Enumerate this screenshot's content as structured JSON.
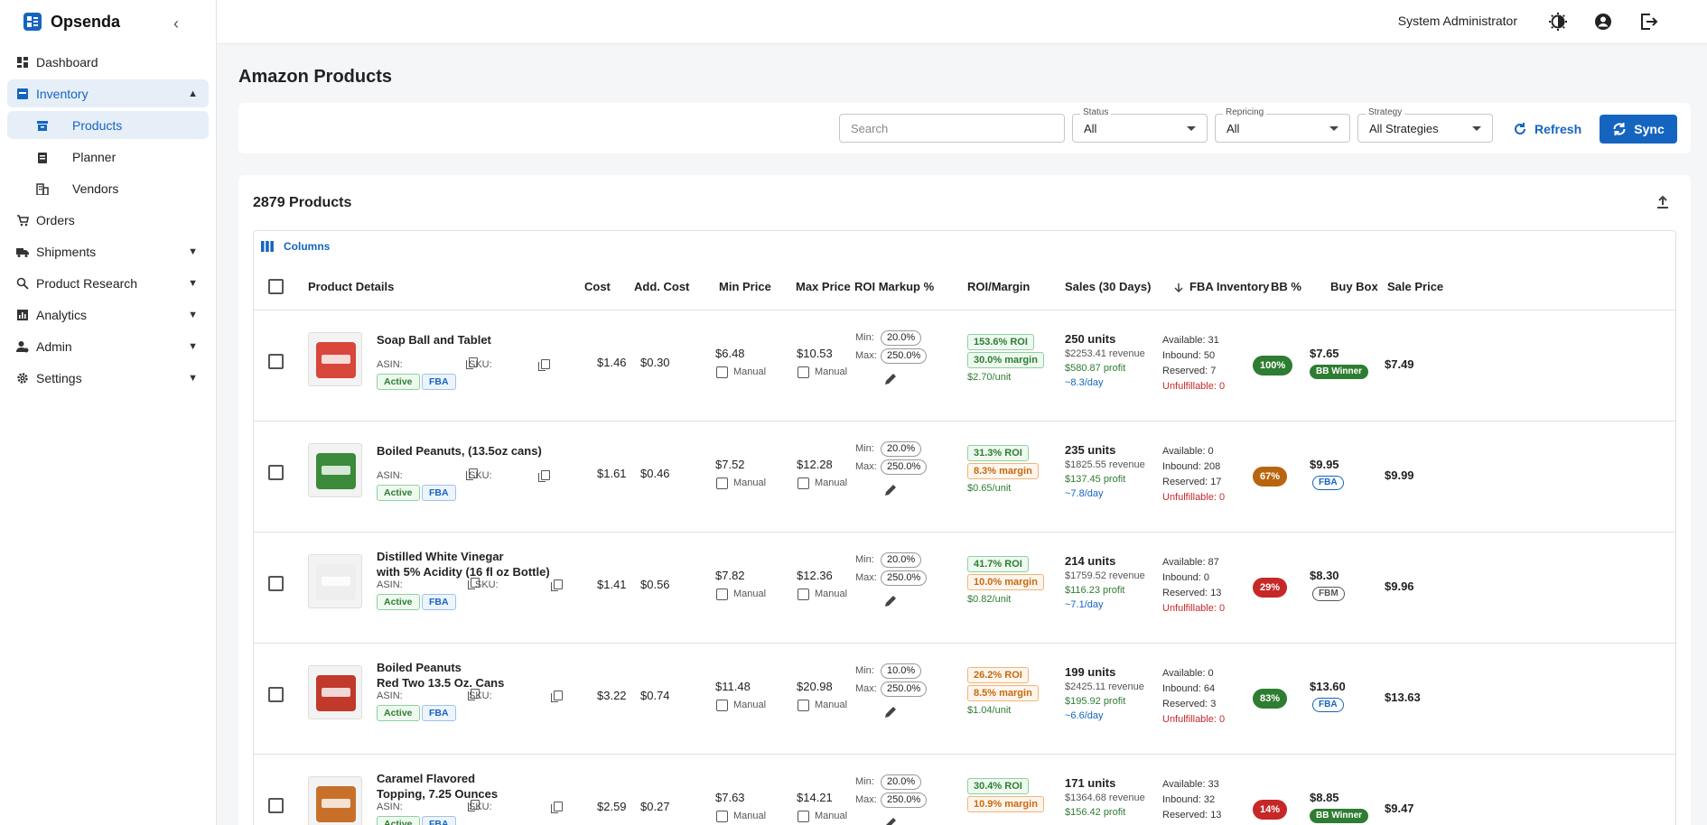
{
  "app": {
    "name": "Opsenda"
  },
  "sidebar": {
    "items": [
      {
        "label": "Dashboard"
      },
      {
        "label": "Inventory"
      },
      {
        "label": "Products"
      },
      {
        "label": "Planner"
      },
      {
        "label": "Vendors"
      },
      {
        "label": "Orders"
      },
      {
        "label": "Shipments"
      },
      {
        "label": "Product Research"
      },
      {
        "label": "Analytics"
      },
      {
        "label": "Admin"
      },
      {
        "label": "Settings"
      }
    ]
  },
  "header": {
    "user": "System Administrator"
  },
  "page": {
    "title": "Amazon Products"
  },
  "filters": {
    "search_placeholder": "Search",
    "status": {
      "label": "Status",
      "value": "All"
    },
    "repricing": {
      "label": "Repricing",
      "value": "All"
    },
    "strategy": {
      "label": "Strategy",
      "value": "All Strategies"
    },
    "refresh_label": "Refresh",
    "sync_label": "Sync"
  },
  "table": {
    "count_label": "2879 Products",
    "columns_button": "Columns",
    "headers": [
      "Product Details",
      "Cost",
      "Add. Cost",
      "Min Price",
      "Max Price",
      "ROI Markup %",
      "ROI/Margin",
      "Sales (30 Days)",
      "FBA Inventory",
      "BB %",
      "Buy Box",
      "Sale Price"
    ],
    "labels": {
      "asin": "ASIN:",
      "sku": "SKU:",
      "manual": "Manual",
      "min": "Min:",
      "max": "Max:"
    },
    "rows": [
      {
        "name_line1": "Soap Ball and Tablet",
        "name_line2": "",
        "status": "Active",
        "channel": "FBA",
        "cost": "$1.46",
        "add_cost": "$0.30",
        "min_price": "$6.48",
        "max_price": "$10.53",
        "roi_min": "20.0%",
        "roi_max": "250.0%",
        "roi": "153.6% ROI",
        "margin": "30.0% margin",
        "per_unit": "$2.70/unit",
        "units": "250 units",
        "revenue": "$2253.41 revenue",
        "profit": "$580.87 profit",
        "per_day": "~8.3/day",
        "available": "Available: 31",
        "inbound": "Inbound: 50",
        "reserved": "Reserved: 7",
        "unfulfillable": "Unfulfillable: 0",
        "bb_pct": "100%",
        "bb_color": "#2e7d32",
        "buybox": "$7.65",
        "buybox_tag": "BB Winner",
        "sale_price": "$7.49"
      },
      {
        "name_line1": "Boiled Peanuts, (13.5oz cans)",
        "name_line2": "",
        "status": "Active",
        "channel": "FBA",
        "cost": "$1.61",
        "add_cost": "$0.46",
        "min_price": "$7.52",
        "max_price": "$12.28",
        "roi_min": "20.0%",
        "roi_max": "250.0%",
        "roi": "31.3% ROI",
        "margin": "8.3% margin",
        "per_unit": "$0.65/unit",
        "units": "235 units",
        "revenue": "$1825.55 revenue",
        "profit": "$137.45 profit",
        "per_day": "~7.8/day",
        "available": "Available: 0",
        "inbound": "Inbound: 208",
        "reserved": "Reserved: 17",
        "unfulfillable": "Unfulfillable: 0",
        "bb_pct": "67%",
        "bb_color": "#b8650f",
        "buybox": "$9.95",
        "buybox_tag": "FBA",
        "sale_price": "$9.99"
      },
      {
        "name_line1": "Distilled White Vinegar",
        "name_line2": "with 5% Acidity (16 fl oz Bottle)",
        "status": "Active",
        "channel": "FBA",
        "cost": "$1.41",
        "add_cost": "$0.56",
        "min_price": "$7.82",
        "max_price": "$12.36",
        "roi_min": "20.0%",
        "roi_max": "250.0%",
        "roi": "41.7% ROI",
        "margin": "10.0% margin",
        "per_unit": "$0.82/unit",
        "units": "214 units",
        "revenue": "$1759.52 revenue",
        "profit": "$116.23 profit",
        "per_day": "~7.1/day",
        "available": "Available: 87",
        "inbound": "Inbound: 0",
        "reserved": "Reserved: 13",
        "unfulfillable": "Unfulfillable: 0",
        "bb_pct": "29%",
        "bb_color": "#c62828",
        "buybox": "$8.30",
        "buybox_tag": "FBM",
        "sale_price": "$9.96"
      },
      {
        "name_line1": "Boiled Peanuts",
        "name_line2": "Red Two 13.5 Oz. Cans",
        "status": "Active",
        "channel": "FBA",
        "cost": "$3.22",
        "add_cost": "$0.74",
        "min_price": "$11.48",
        "max_price": "$20.98",
        "roi_min": "10.0%",
        "roi_max": "250.0%",
        "roi": "26.2% ROI",
        "margin": "8.5% margin",
        "per_unit": "$1.04/unit",
        "units": "199 units",
        "revenue": "$2425.11 revenue",
        "profit": "$195.92 profit",
        "per_day": "~6.6/day",
        "available": "Available: 0",
        "inbound": "Inbound: 64",
        "reserved": "Reserved: 3",
        "unfulfillable": "Unfulfillable: 0",
        "bb_pct": "83%",
        "bb_color": "#2e7d32",
        "buybox": "$13.60",
        "buybox_tag": "FBA",
        "sale_price": "$13.63"
      },
      {
        "name_line1": "Caramel Flavored",
        "name_line2": "Topping, 7.25 Ounces",
        "status": "Active",
        "channel": "FBA",
        "cost": "$2.59",
        "add_cost": "$0.27",
        "min_price": "$7.63",
        "max_price": "$14.21",
        "roi_min": "20.0%",
        "roi_max": "250.0%",
        "roi": "30.4% ROI",
        "margin": "10.9% margin",
        "per_unit": "",
        "units": "171 units",
        "revenue": "$1364.68 revenue",
        "profit": "$156.42 profit",
        "per_day": "",
        "available": "Available: 33",
        "inbound": "Inbound: 32",
        "reserved": "Reserved: 13",
        "unfulfillable": "",
        "bb_pct": "14%",
        "bb_color": "#c62828",
        "buybox": "$8.85",
        "buybox_tag": "BB Winner",
        "sale_price": "$9.47"
      }
    ]
  }
}
